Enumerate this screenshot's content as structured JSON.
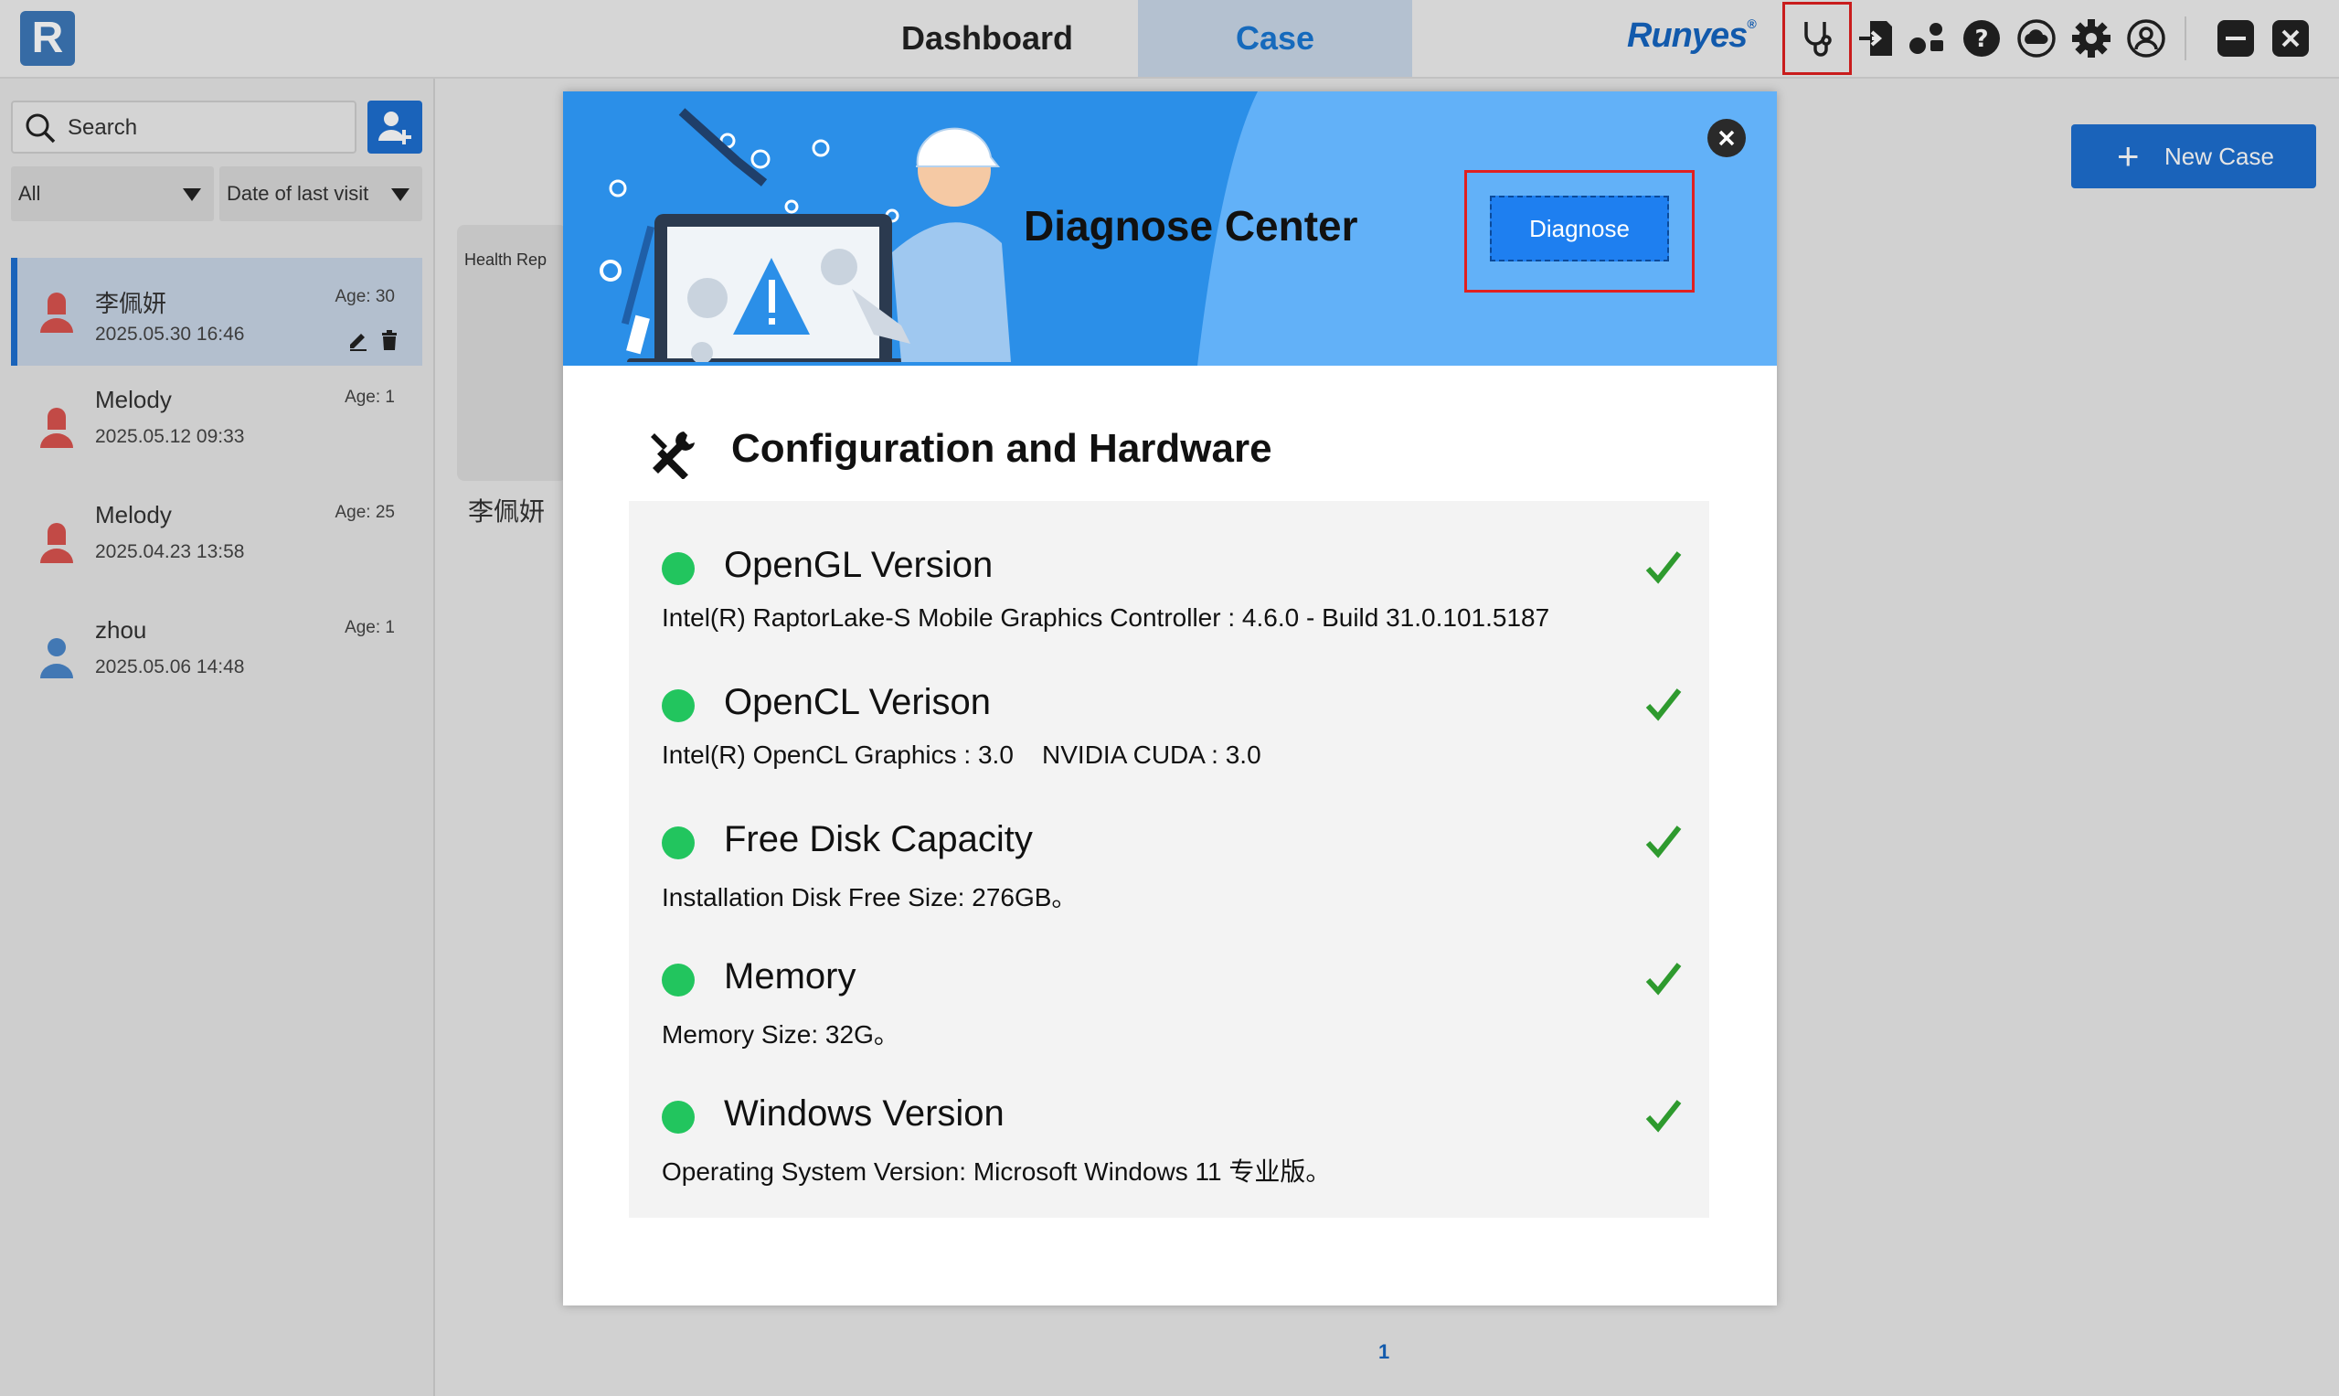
{
  "app": {
    "logo_letter": "R",
    "brand": "Runyes",
    "brand_mark": "®"
  },
  "tabs": [
    {
      "label": "Dashboard",
      "active": false
    },
    {
      "label": "Case",
      "active": true
    }
  ],
  "toolbar_icons": [
    "stethoscope-icon",
    "import-icon",
    "share-icon",
    "help-icon",
    "cloud-icon",
    "settings-icon",
    "user-icon",
    "minimize-icon",
    "close-icon"
  ],
  "sidebar": {
    "search_placeholder": "Search",
    "filter_group": "All",
    "filter_sort": "Date of last visit",
    "patients": [
      {
        "name": "李佩妍",
        "date": "2025.05.30 16:46",
        "age": "Age: 30",
        "gender": "female",
        "selected": true
      },
      {
        "name": "Melody",
        "date": "2025.05.12 09:33",
        "age": "Age: 1",
        "gender": "female",
        "selected": false
      },
      {
        "name": "Melody",
        "date": "2025.04.23 13:58",
        "age": "Age: 25",
        "gender": "female",
        "selected": false
      },
      {
        "name": "zhou",
        "date": "2025.05.06 14:48",
        "age": "Age: 1",
        "gender": "male",
        "selected": false
      }
    ]
  },
  "main": {
    "card_tag": "Health Rep",
    "card_name": "李佩妍",
    "new_case_label": "New Case",
    "page_number": "1"
  },
  "dialog": {
    "title": "Diagnose Center",
    "diagnose_label": "Diagnose",
    "section_title": "Configuration and Hardware",
    "items": [
      {
        "name": "OpenGL Version",
        "detail": "Intel(R) RaptorLake-S Mobile Graphics Controller : 4.6.0 - Build 31.0.101.5187",
        "status": "ok"
      },
      {
        "name": "OpenCL Verison",
        "detail": "Intel(R) OpenCL Graphics : 3.0    NVIDIA CUDA : 3.0",
        "status": "ok"
      },
      {
        "name": "Free Disk Capacity",
        "detail": "Installation Disk Free Size: 276GB。",
        "status": "ok"
      },
      {
        "name": "Memory",
        "detail": "Memory Size: 32G。",
        "status": "ok"
      },
      {
        "name": "Windows Version",
        "detail": "Operating System Version: Microsoft Windows 11 专业版。",
        "status": "ok"
      }
    ]
  },
  "colors": {
    "accent": "#1e6fd0",
    "banner": "#2b8fe8",
    "ok": "#22c55e",
    "check": "#2e9a2e",
    "highlight": "#e02020"
  }
}
